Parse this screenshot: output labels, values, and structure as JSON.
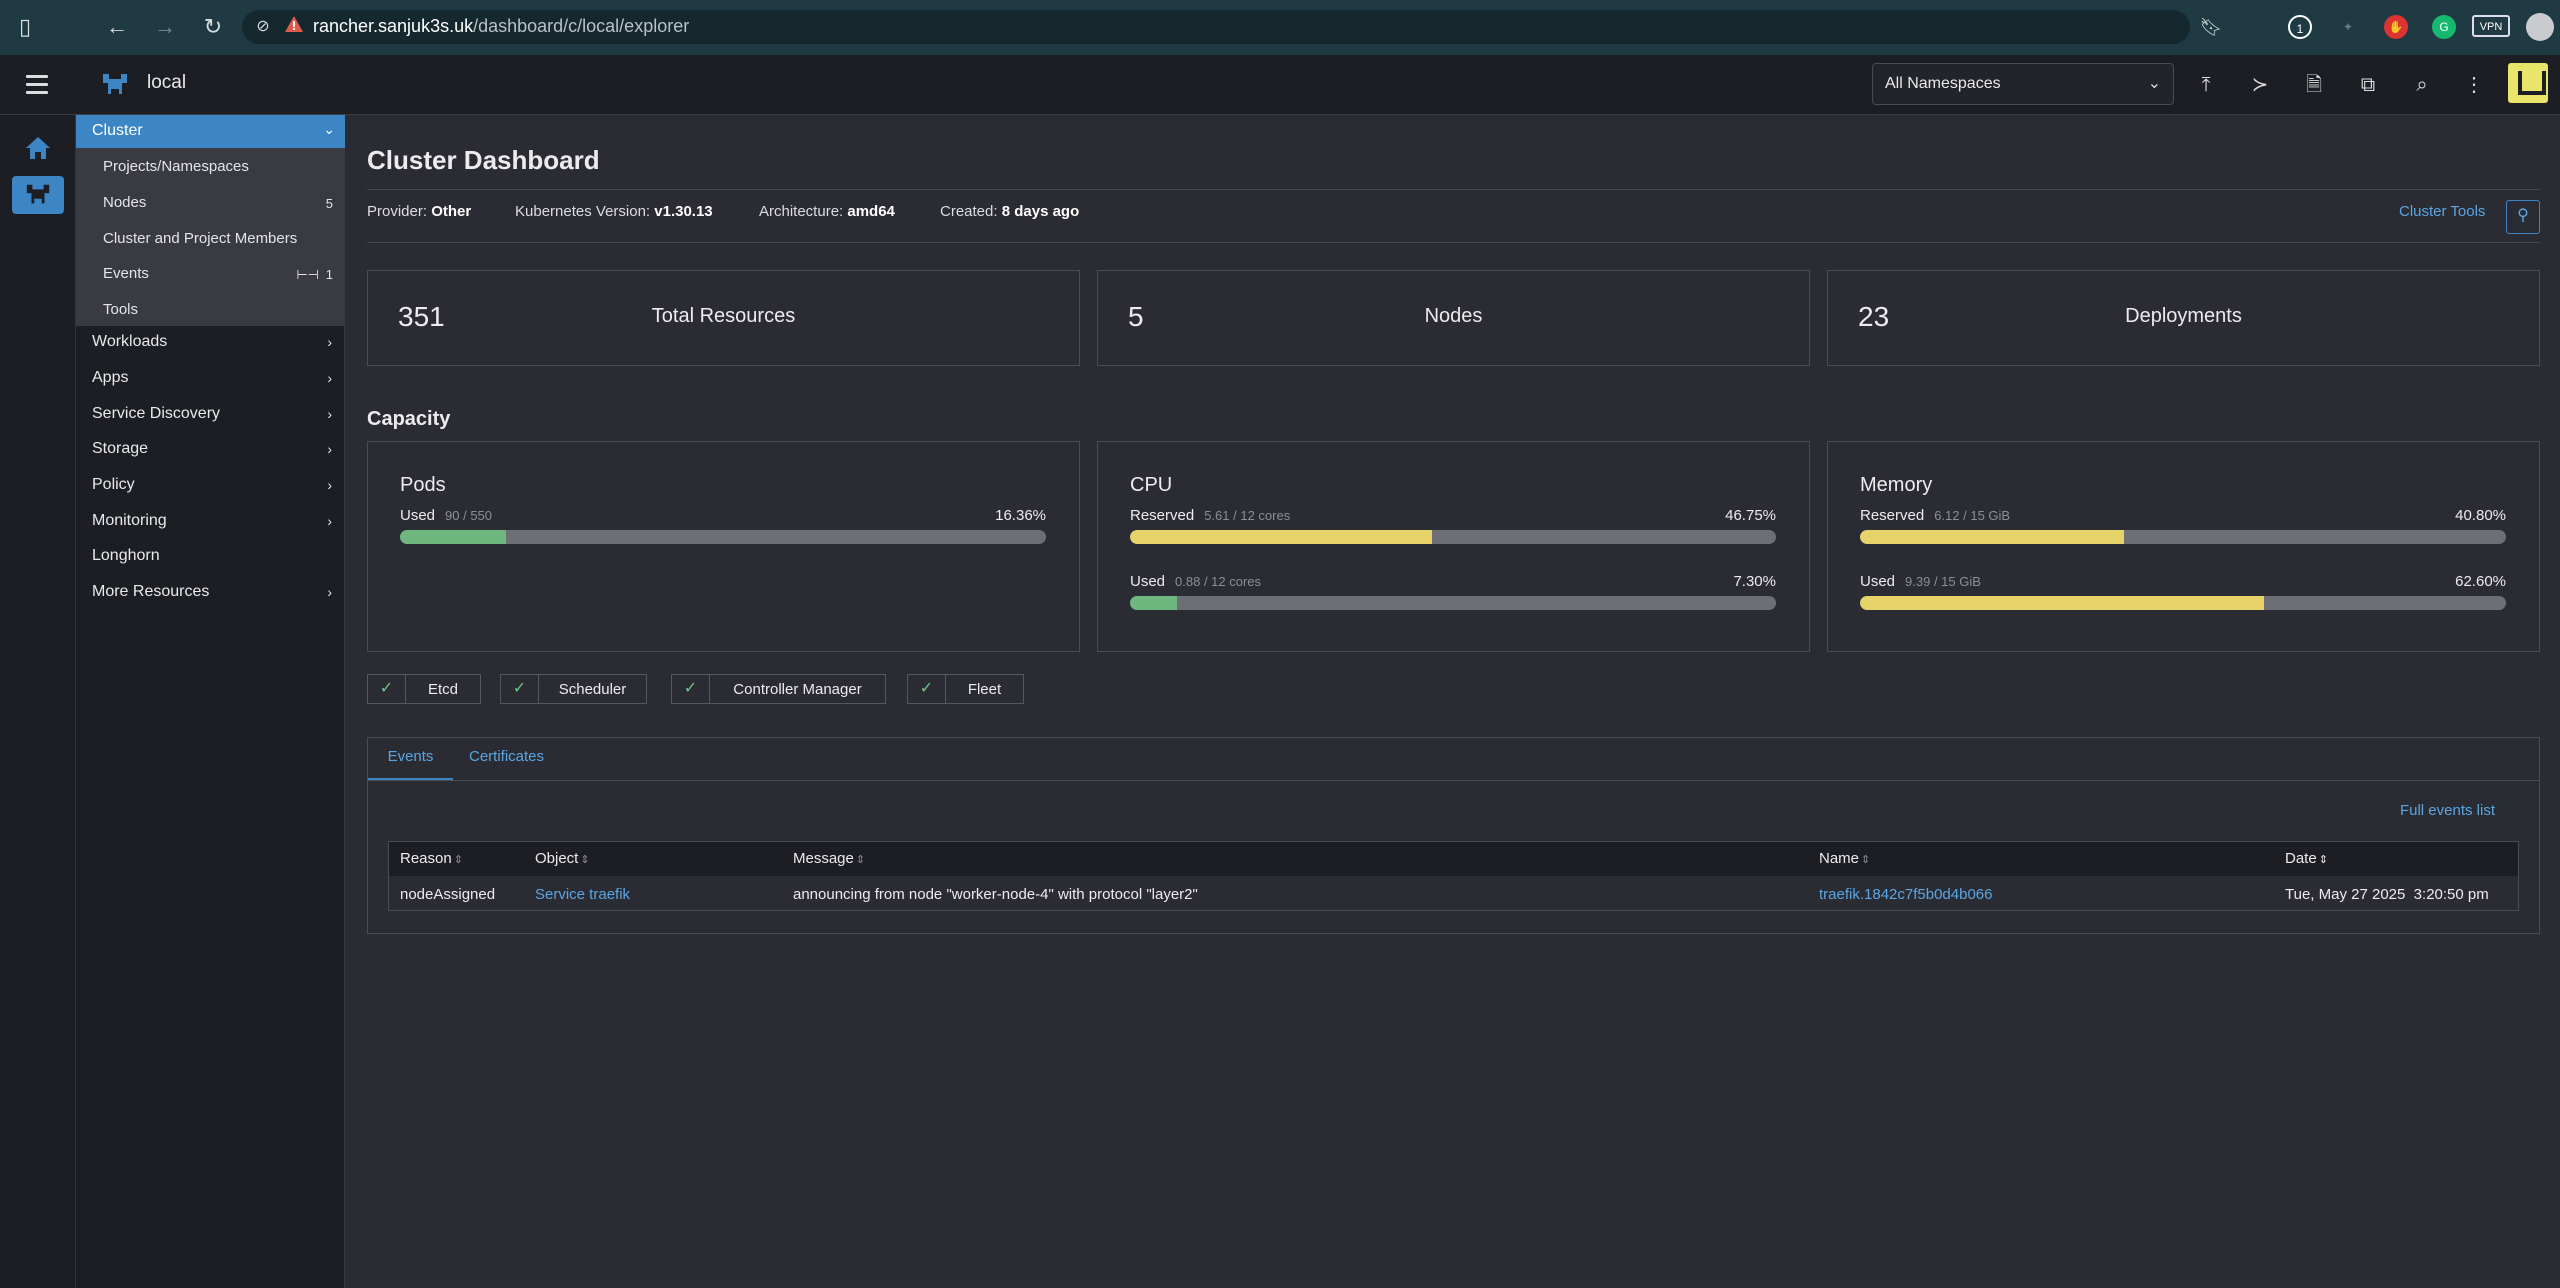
{
  "browser": {
    "url_host": "rancher.sanjuk3s.uk",
    "url_path": "/dashboard/c/local/explorer"
  },
  "header": {
    "cluster_name": "local",
    "namespace_select": "All Namespaces"
  },
  "sidebar": {
    "group": {
      "label": "Cluster",
      "items": [
        {
          "label": "Projects/Namespaces",
          "count": ""
        },
        {
          "label": "Nodes",
          "count": "5"
        },
        {
          "label": "Cluster and Project Members",
          "count": ""
        },
        {
          "label": "Events",
          "count": "1"
        },
        {
          "label": "Tools",
          "count": ""
        }
      ]
    },
    "items": [
      {
        "label": "Workloads",
        "expandable": true
      },
      {
        "label": "Apps",
        "expandable": true
      },
      {
        "label": "Service Discovery",
        "expandable": true
      },
      {
        "label": "Storage",
        "expandable": true
      },
      {
        "label": "Policy",
        "expandable": true
      },
      {
        "label": "Monitoring",
        "expandable": true
      },
      {
        "label": "Longhorn",
        "expandable": false
      },
      {
        "label": "More Resources",
        "expandable": true
      }
    ]
  },
  "main": {
    "title": "Cluster Dashboard",
    "meta": {
      "provider_label": "Provider:",
      "provider": "Other",
      "k8s_label": "Kubernetes Version:",
      "k8s": "v1.30.13",
      "arch_label": "Architecture:",
      "arch": "amd64",
      "created_label": "Created:",
      "created": "8 days ago"
    },
    "cluster_tools": "Cluster Tools",
    "counts": [
      {
        "value": "351",
        "label": "Total Resources"
      },
      {
        "value": "5",
        "label": "Nodes"
      },
      {
        "value": "23",
        "label": "Deployments"
      }
    ],
    "capacity_title": "Capacity",
    "capacity": {
      "pods": {
        "title": "Pods",
        "bars": [
          {
            "label": "Used",
            "sub": "90 / 550",
            "pct": "16.36%",
            "fraction": 0.1636,
            "color": "#6fb77e"
          }
        ]
      },
      "cpu": {
        "title": "CPU",
        "bars": [
          {
            "label": "Reserved",
            "sub": "5.61 / 12 cores",
            "pct": "46.75%",
            "fraction": 0.4675,
            "color": "#e6d36a"
          },
          {
            "label": "Used",
            "sub": "0.88 / 12 cores",
            "pct": "7.30%",
            "fraction": 0.073,
            "color": "#6fb77e"
          }
        ]
      },
      "memory": {
        "title": "Memory",
        "bars": [
          {
            "label": "Reserved",
            "sub": "6.12 / 15 GiB",
            "pct": "40.80%",
            "fraction": 0.408,
            "color": "#e6d36a"
          },
          {
            "label": "Used",
            "sub": "9.39 / 15 GiB",
            "pct": "62.60%",
            "fraction": 0.626,
            "color": "#e6d36a"
          }
        ]
      }
    },
    "components": [
      "Etcd",
      "Scheduler",
      "Controller Manager",
      "Fleet"
    ],
    "tabs": [
      "Events",
      "Certificates"
    ],
    "full_events": "Full events list",
    "table": {
      "headers": [
        "Reason",
        "Object",
        "Message",
        "Name",
        "Date"
      ],
      "rows": [
        [
          "nodeAssigned",
          "Service traefik",
          "announcing from node \"worker-node-4\" with protocol \"layer2\"",
          "traefik.1842c7f5b0d4b066",
          "Tue, May 27 2025  3:20:50 pm"
        ]
      ]
    }
  }
}
